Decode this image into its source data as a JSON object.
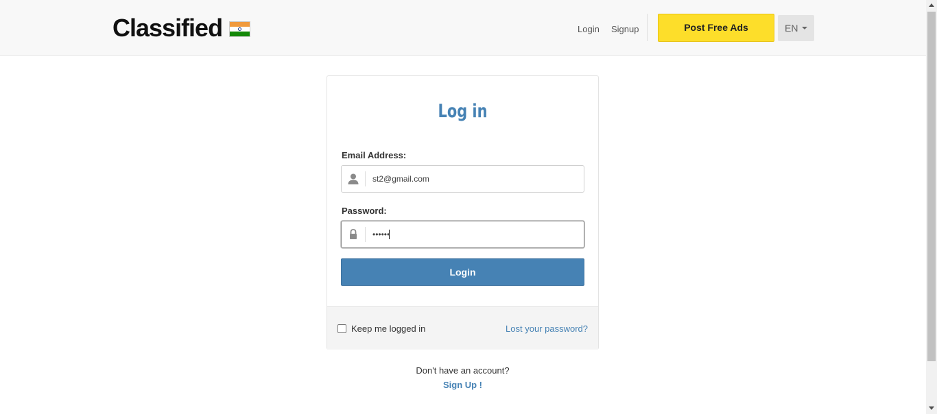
{
  "header": {
    "logo_text": "Classified",
    "flag_icon": "india-flag-icon",
    "nav": {
      "login": "Login",
      "signup": "Signup"
    },
    "post_ads_label": "Post Free Ads",
    "language": "EN"
  },
  "login_card": {
    "title": "Log in",
    "email_label": "Email Address:",
    "email_value": "st2@gmail.com",
    "email_icon": "user-icon",
    "password_label": "Password:",
    "password_value": "••••••",
    "password_icon": "lock-icon",
    "login_button": "Login",
    "keep_logged_in": "Keep me logged in",
    "lost_password": "Lost your password?"
  },
  "footer": {
    "no_account": "Don't have an account?",
    "signup_link": "Sign Up !"
  },
  "colors": {
    "accent": "#4682b4",
    "post_button": "#fdde2a",
    "header_bg": "#f8f8f8"
  }
}
